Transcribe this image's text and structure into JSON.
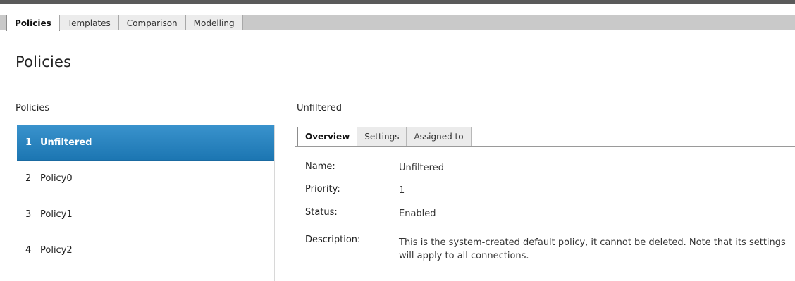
{
  "top_tabs": [
    {
      "label": "Policies"
    },
    {
      "label": "Templates"
    },
    {
      "label": "Comparison"
    },
    {
      "label": "Modelling"
    }
  ],
  "page": {
    "title": "Policies"
  },
  "list": {
    "header": "Policies",
    "items": [
      {
        "num": "1",
        "label": "Unfiltered"
      },
      {
        "num": "2",
        "label": "Policy0"
      },
      {
        "num": "3",
        "label": "Policy1"
      },
      {
        "num": "4",
        "label": "Policy2"
      }
    ]
  },
  "detail": {
    "title": "Unfiltered",
    "tabs": [
      {
        "label": "Overview"
      },
      {
        "label": "Settings"
      },
      {
        "label": "Assigned to"
      }
    ],
    "fields": {
      "name_label": "Name:",
      "name_value": "Unfiltered",
      "priority_label": "Priority:",
      "priority_value": "1",
      "status_label": "Status:",
      "status_value": "Enabled",
      "description_label": "Description:",
      "description_value": "This is the system-created default policy, it cannot be deleted. Note that its settings will apply to all connections."
    }
  },
  "colors": {
    "selected_bg": "#2584c0",
    "topbar_bg": "#c9c9c9",
    "topbar_strip": "#5a5a5a"
  }
}
